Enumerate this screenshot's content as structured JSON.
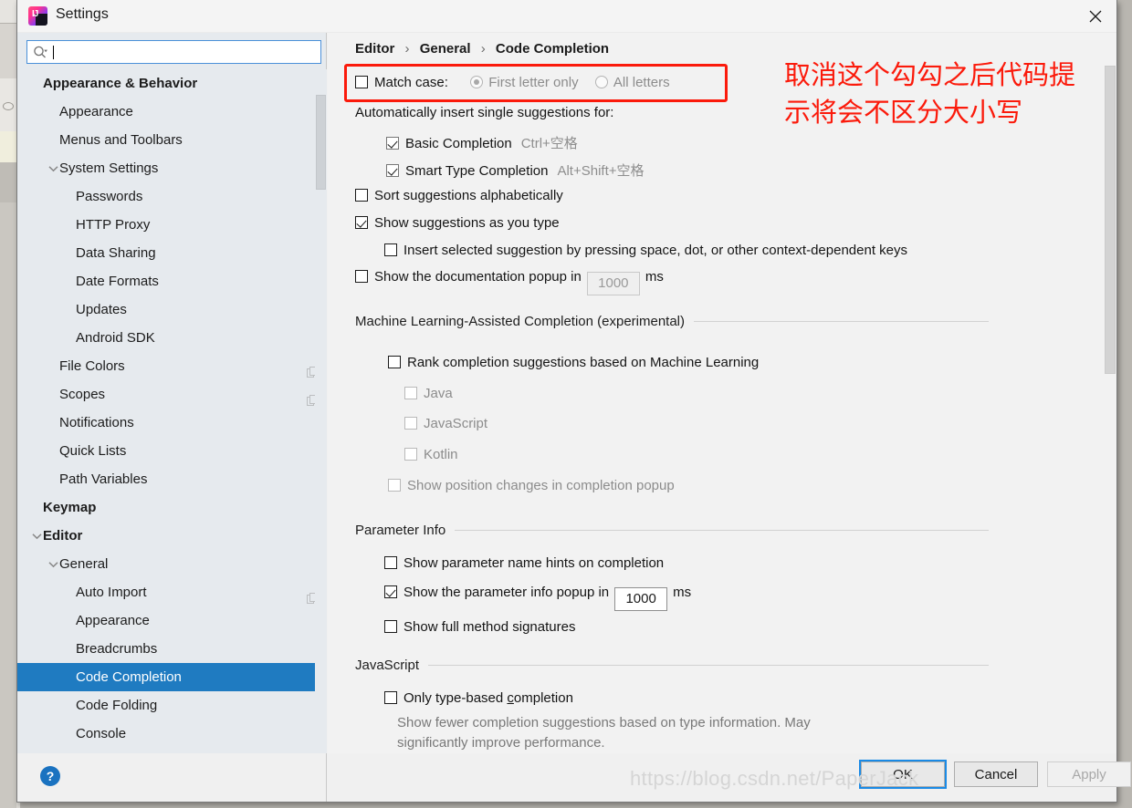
{
  "window": {
    "title": "Settings",
    "app_icon": "intellij-idea-icon",
    "close_icon": "close-icon"
  },
  "search": {
    "value": "",
    "placeholder": "",
    "icon": "search-icon"
  },
  "sidebar": {
    "items": [
      {
        "label": "Appearance & Behavior",
        "depth": 0,
        "bold": true,
        "twisty": "",
        "badge": false,
        "selected": false
      },
      {
        "label": "Appearance",
        "depth": 1,
        "bold": false,
        "twisty": "",
        "badge": false,
        "selected": false
      },
      {
        "label": "Menus and Toolbars",
        "depth": 1,
        "bold": false,
        "twisty": "",
        "badge": false,
        "selected": false
      },
      {
        "label": "System Settings",
        "depth": 1,
        "bold": false,
        "twisty": "expanded",
        "badge": false,
        "selected": false
      },
      {
        "label": "Passwords",
        "depth": 2,
        "bold": false,
        "twisty": "",
        "badge": false,
        "selected": false
      },
      {
        "label": "HTTP Proxy",
        "depth": 2,
        "bold": false,
        "twisty": "",
        "badge": false,
        "selected": false
      },
      {
        "label": "Data Sharing",
        "depth": 2,
        "bold": false,
        "twisty": "",
        "badge": false,
        "selected": false
      },
      {
        "label": "Date Formats",
        "depth": 2,
        "bold": false,
        "twisty": "",
        "badge": false,
        "selected": false
      },
      {
        "label": "Updates",
        "depth": 2,
        "bold": false,
        "twisty": "",
        "badge": false,
        "selected": false
      },
      {
        "label": "Android SDK",
        "depth": 2,
        "bold": false,
        "twisty": "",
        "badge": false,
        "selected": false
      },
      {
        "label": "File Colors",
        "depth": 1,
        "bold": false,
        "twisty": "",
        "badge": true,
        "selected": false
      },
      {
        "label": "Scopes",
        "depth": 1,
        "bold": false,
        "twisty": "",
        "badge": true,
        "selected": false
      },
      {
        "label": "Notifications",
        "depth": 1,
        "bold": false,
        "twisty": "",
        "badge": false,
        "selected": false
      },
      {
        "label": "Quick Lists",
        "depth": 1,
        "bold": false,
        "twisty": "",
        "badge": false,
        "selected": false
      },
      {
        "label": "Path Variables",
        "depth": 1,
        "bold": false,
        "twisty": "",
        "badge": false,
        "selected": false
      },
      {
        "label": "Keymap",
        "depth": 0,
        "bold": true,
        "twisty": "",
        "badge": false,
        "selected": false
      },
      {
        "label": "Editor",
        "depth": 0,
        "bold": true,
        "twisty": "expanded",
        "badge": false,
        "selected": false
      },
      {
        "label": "General",
        "depth": 1,
        "bold": false,
        "twisty": "expanded",
        "badge": false,
        "selected": false
      },
      {
        "label": "Auto Import",
        "depth": 2,
        "bold": false,
        "twisty": "",
        "badge": true,
        "selected": false
      },
      {
        "label": "Appearance",
        "depth": 2,
        "bold": false,
        "twisty": "",
        "badge": false,
        "selected": false
      },
      {
        "label": "Breadcrumbs",
        "depth": 2,
        "bold": false,
        "twisty": "",
        "badge": false,
        "selected": false
      },
      {
        "label": "Code Completion",
        "depth": 2,
        "bold": false,
        "twisty": "",
        "badge": false,
        "selected": true
      },
      {
        "label": "Code Folding",
        "depth": 2,
        "bold": false,
        "twisty": "",
        "badge": false,
        "selected": false
      },
      {
        "label": "Console",
        "depth": 2,
        "bold": false,
        "twisty": "",
        "badge": false,
        "selected": false
      }
    ],
    "help_label": "?"
  },
  "breadcrumb": {
    "part1": "Editor",
    "part2": "General",
    "part3": "Code Completion",
    "separator": "›"
  },
  "settings": {
    "match_case": {
      "label": "Match case:",
      "checked": false,
      "option_first": "First letter only",
      "option_all": "All letters",
      "option_selected": "First letter only",
      "disabled": true
    },
    "auto_insert_header": "Automatically insert single suggestions for:",
    "basic_completion": {
      "label": "Basic Completion",
      "shortcut": "Ctrl+空格",
      "checked": true
    },
    "smart_type_completion": {
      "label": "Smart Type Completion",
      "shortcut": "Alt+Shift+空格",
      "checked": true
    },
    "sort_alphabetically": {
      "label": "Sort suggestions alphabetically",
      "checked": false
    },
    "show_as_you_type": {
      "label": "Show suggestions as you type",
      "checked": true
    },
    "insert_selected": {
      "label": "Insert selected suggestion by pressing space, dot, or other context-dependent keys",
      "checked": false
    },
    "doc_popup": {
      "label": "Show the documentation popup in",
      "value": "1000",
      "unit": "ms",
      "checked": false,
      "disabled": true
    },
    "ml_section": "Machine Learning-Assisted Completion (experimental)",
    "ml_rank": {
      "label": "Rank completion suggestions based on Machine Learning",
      "checked": false
    },
    "ml_java": {
      "label": "Java",
      "checked": false,
      "disabled": true
    },
    "ml_javascript": {
      "label": "JavaScript",
      "checked": false,
      "disabled": true
    },
    "ml_kotlin": {
      "label": "Kotlin",
      "checked": false,
      "disabled": true
    },
    "ml_position": {
      "label": "Show position changes in completion popup",
      "checked": false,
      "disabled": true
    },
    "param_section": "Parameter Info",
    "param_hints": {
      "label": "Show parameter name hints on completion",
      "checked": false
    },
    "param_popup": {
      "label": "Show the parameter info popup in",
      "value": "1000",
      "unit": "ms",
      "checked": true
    },
    "param_signatures": {
      "label": "Show full method signatures",
      "checked": false
    },
    "js_section": "JavaScript",
    "js_type_based_pre": "Only type-based ",
    "js_type_based_mnemonic": "c",
    "js_type_based_post": "ompletion",
    "js_type_based_checked": false,
    "js_description": "Show fewer completion suggestions based on type information. May\nsignificantly improve performance."
  },
  "annotation": {
    "text": "取消这个勾勾之后代码提\n示将会不区分大小写",
    "color": "#fb1a0b"
  },
  "buttons": {
    "ok": "OK",
    "cancel": "Cancel",
    "apply": "Apply"
  },
  "watermark": "https://blog.csdn.net/PaperJack",
  "colors": {
    "selection": "#1f7bc1",
    "accent": "#1a8ae5",
    "annotation_red": "#fb1a0b",
    "sidebar_bg": "#e6eaee",
    "content_bg": "#f2f2f2"
  }
}
